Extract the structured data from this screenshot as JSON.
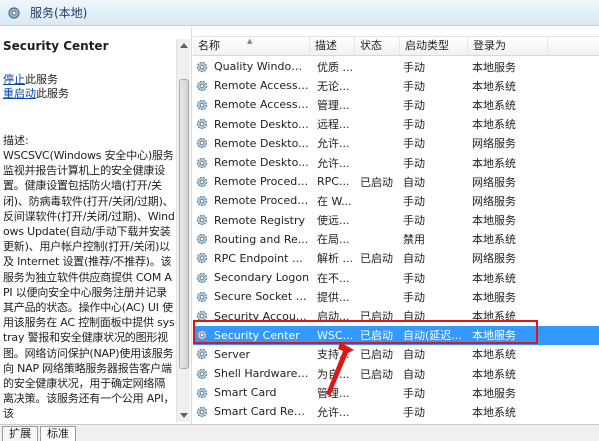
{
  "window": {
    "title": "服务(本地)"
  },
  "left_pane": {
    "service_name": "Security Center",
    "actions": [
      {
        "link": "停止",
        "suffix": "此服务"
      },
      {
        "link": "重启动",
        "suffix": "此服务"
      }
    ],
    "description_label": "描述:",
    "description": "WSCSVC(Windows 安全中心)服务监视并报告计算机上的安全健康设置。健康设置包括防火墙(打开/关闭)、防病毒软件(打开/关闭/过期)、反间谍软件(打开/关闭/过期)、Windows Update(自动/手动下载并安装更新)、用户帐户控制(打开/关闭)以及 Internet 设置(推荐/不推荐)。该服务为独立软件供应商提供 COM API 以便向安全中心服务注册并记录其产品的状态。操作中心(AC) UI 使用该服务在 AC 控制面板中提供 systray 警报和安全健康状况的图形视图。网络访问保护(NAP)使用该服务向 NAP 网络策略服务器报告客户端的安全健康状况，用于确定网络隔离决策。该服务还有一个公用 API，该"
  },
  "columns": [
    "名称",
    "描述",
    "状态",
    "启动类型",
    "登录为"
  ],
  "services": [
    {
      "name": "Quality Windows...",
      "desc": "优质 ...",
      "status": "",
      "startup": "手动",
      "logon": "本地服务"
    },
    {
      "name": "Remote Access ...",
      "desc": "无论...",
      "status": "",
      "startup": "手动",
      "logon": "本地系统"
    },
    {
      "name": "Remote Access ...",
      "desc": "管理...",
      "status": "",
      "startup": "手动",
      "logon": "本地系统"
    },
    {
      "name": "Remote Deskto...",
      "desc": "远程...",
      "status": "",
      "startup": "手动",
      "logon": "本地系统"
    },
    {
      "name": "Remote Deskto...",
      "desc": "允许...",
      "status": "",
      "startup": "手动",
      "logon": "网络服务"
    },
    {
      "name": "Remote Deskto...",
      "desc": "允许...",
      "status": "",
      "startup": "手动",
      "logon": "本地系统"
    },
    {
      "name": "Remote Procedu...",
      "desc": "RPC...",
      "status": "已启动",
      "startup": "自动",
      "logon": "网络服务"
    },
    {
      "name": "Remote Procedu...",
      "desc": "在 W...",
      "status": "",
      "startup": "手动",
      "logon": "网络服务"
    },
    {
      "name": "Remote Registry",
      "desc": "使远...",
      "status": "",
      "startup": "手动",
      "logon": "本地服务"
    },
    {
      "name": "Routing and Re...",
      "desc": "在局...",
      "status": "",
      "startup": "禁用",
      "logon": "本地系统"
    },
    {
      "name": "RPC Endpoint M...",
      "desc": "解析 ...",
      "status": "已启动",
      "startup": "自动",
      "logon": "网络服务"
    },
    {
      "name": "Secondary Logon",
      "desc": "在不...",
      "status": "",
      "startup": "手动",
      "logon": "本地系统"
    },
    {
      "name": "Secure Socket T...",
      "desc": "提供...",
      "status": "",
      "startup": "手动",
      "logon": "本地服务"
    },
    {
      "name": "Security Account...",
      "desc": "启动...",
      "status": "已启动",
      "startup": "自动",
      "logon": "本地系统"
    },
    {
      "name": "Security Center",
      "desc": "WSC...",
      "status": "已启动",
      "startup": "自动(延迟...",
      "logon": "本地服务",
      "selected": true
    },
    {
      "name": "Server",
      "desc": "支持...",
      "status": "已启动",
      "startup": "自动",
      "logon": "本地系统"
    },
    {
      "name": "Shell Hardware ...",
      "desc": "为自...",
      "status": "已启动",
      "startup": "自动",
      "logon": "本地系统"
    },
    {
      "name": "Smart Card",
      "desc": "管理...",
      "status": "",
      "startup": "手动",
      "logon": "本地服务"
    },
    {
      "name": "Smart Card Rem...",
      "desc": "允许...",
      "status": "",
      "startup": "手动",
      "logon": "本地系统"
    }
  ],
  "status_tabs": [
    {
      "label": "扩展",
      "active": false
    },
    {
      "label": "标准",
      "active": true
    }
  ],
  "colors": {
    "selection": "#3399ff",
    "highlight": "#e01515",
    "link": "#0645ad"
  },
  "icons": {
    "title": "services-icon",
    "service": "gear-icon"
  }
}
